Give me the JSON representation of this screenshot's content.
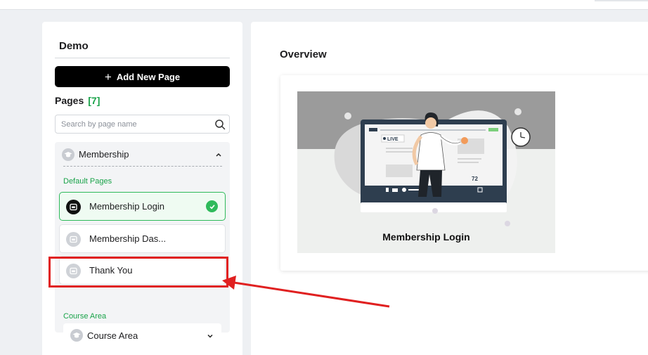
{
  "sidebar": {
    "site_title": "Demo",
    "add_button_label": "Add New Page",
    "pages_label": "Pages",
    "pages_count": "[7]",
    "search_placeholder": "Search by page name",
    "group": {
      "title": "Membership",
      "expanded": true,
      "section_label": "Default Pages",
      "pages": [
        {
          "label": "Membership Login",
          "active": true
        },
        {
          "label": "Membership Das...",
          "active": false
        },
        {
          "label": "Thank You",
          "active": false
        }
      ],
      "course_section_label": "Course Area",
      "course_dropdown_label": "Course Area"
    }
  },
  "main": {
    "heading": "Overview",
    "preview": {
      "caption": "Membership Login",
      "screen_live_badge": "LIVE",
      "screen_viewers": "72"
    }
  },
  "colors": {
    "accent_green": "#1aa34a",
    "annotation_red": "#e02020",
    "button_black": "#000000"
  },
  "icons": [
    "plus-icon",
    "search-icon",
    "graduation-cap-icon",
    "chevron-up-icon",
    "chevron-down-icon",
    "page-icon",
    "check-icon"
  ]
}
